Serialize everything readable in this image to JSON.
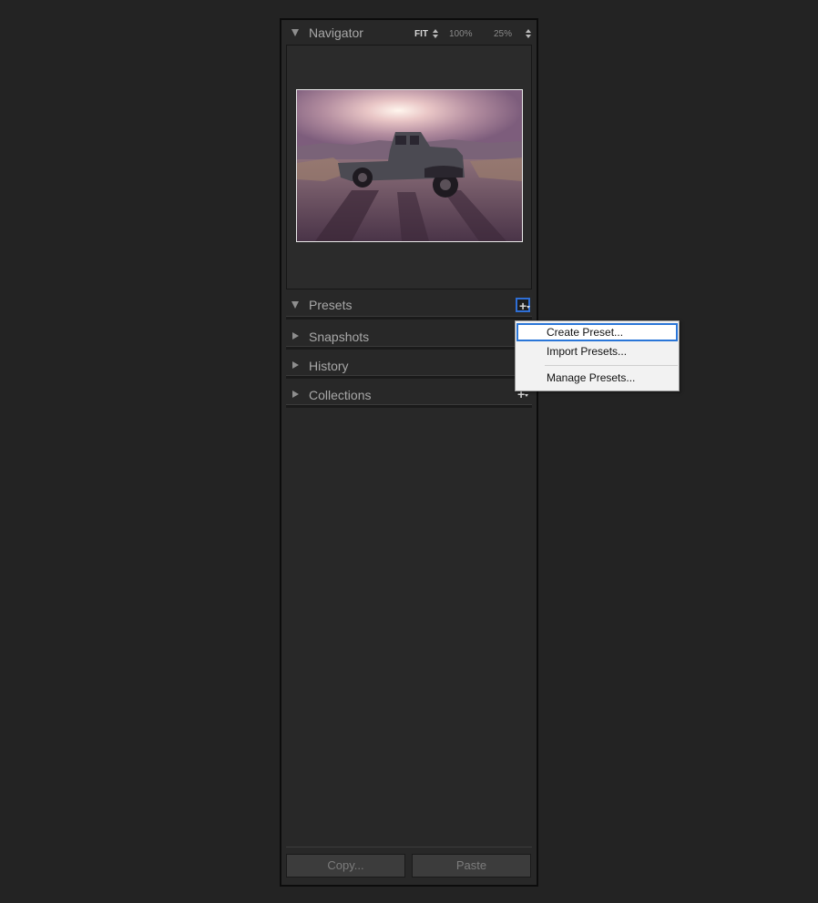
{
  "navigator": {
    "title": "Navigator",
    "zoom_options": [
      "FIT",
      "100%",
      "25%"
    ],
    "active_zoom": "FIT"
  },
  "sections": [
    {
      "label": "Presets",
      "expanded": true,
      "has_add_button": true
    },
    {
      "label": "Snapshots",
      "expanded": false,
      "has_add_button": false
    },
    {
      "label": "History",
      "expanded": false,
      "has_add_button": false
    },
    {
      "label": "Collections",
      "expanded": false,
      "has_add_button": true
    }
  ],
  "context_menu": {
    "items": [
      "Create Preset...",
      "Import Presets...",
      "Manage Presets..."
    ],
    "selected": "Create Preset..."
  },
  "buttons": {
    "copy": "Copy...",
    "paste": "Paste"
  },
  "icons": {
    "expanded": "triangle-down-icon",
    "collapsed": "triangle-right-icon",
    "add": "plus-icon",
    "zoom_stepper": "up-down-arrows-icon"
  },
  "colors": {
    "panel_bg": "#282828",
    "page_bg": "#232323",
    "focus_accent": "#2a76d8",
    "menu_bg": "#f2f2f2"
  }
}
